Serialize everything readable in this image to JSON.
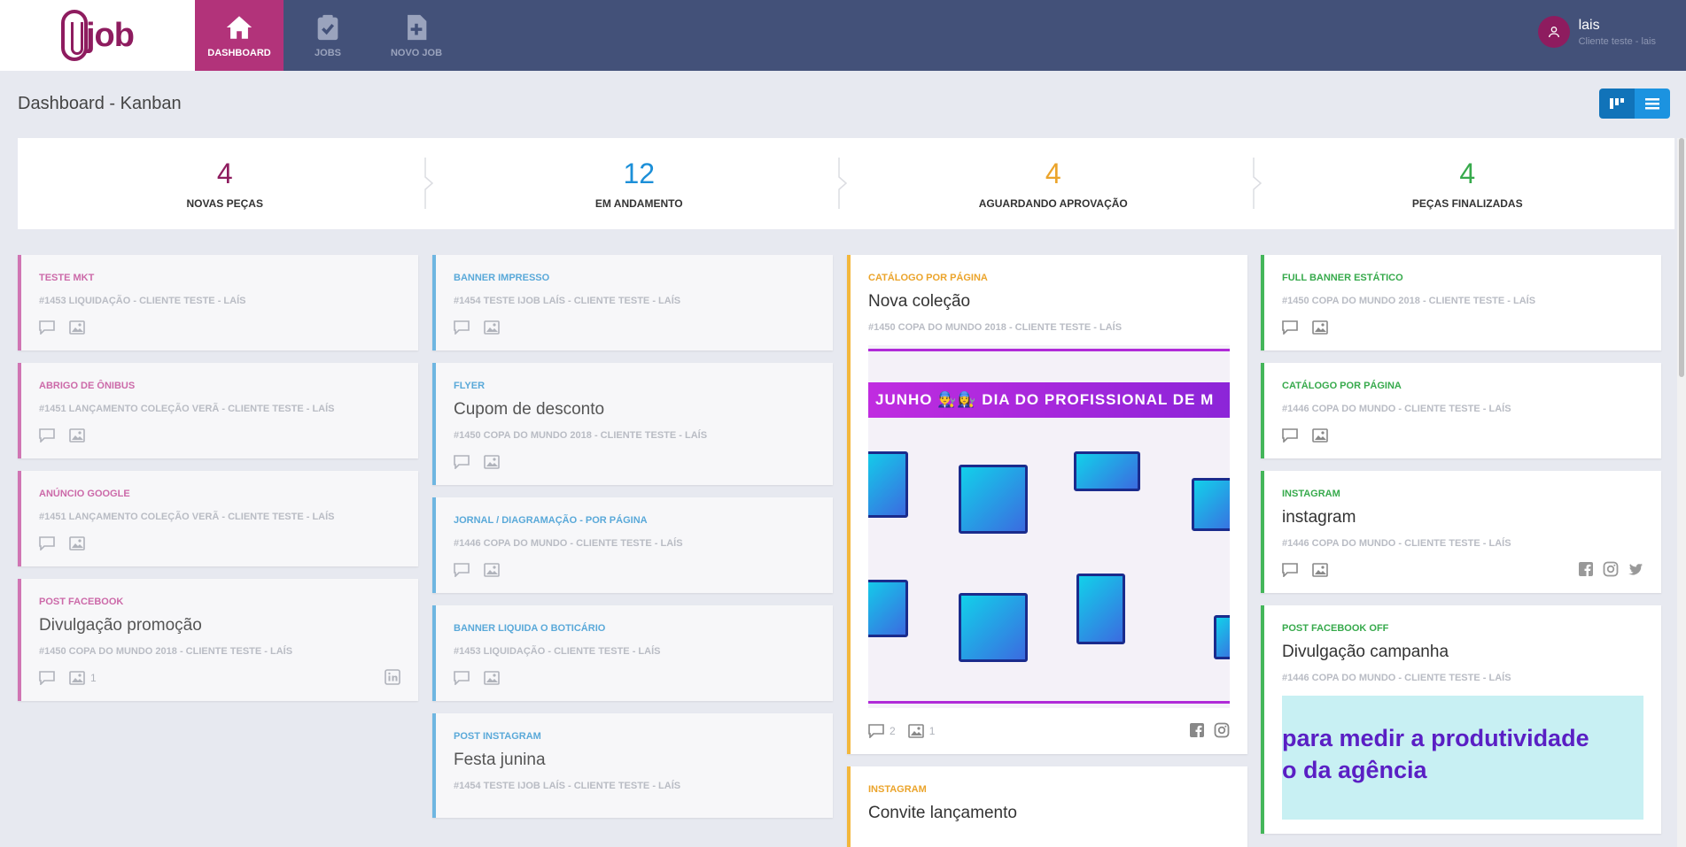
{
  "brand": {
    "logo_text": "job",
    "accent": "#b2337a",
    "nav_bg": "#435179"
  },
  "nav": [
    {
      "label": "DASHBOARD",
      "icon": "home-icon",
      "active": true
    },
    {
      "label": "JOBS",
      "icon": "clipboard-check-icon",
      "active": false
    },
    {
      "label": "NOVO JOB",
      "icon": "file-plus-icon",
      "active": false
    }
  ],
  "user": {
    "name": "lais",
    "subtitle": "Cliente teste - lais"
  },
  "page": {
    "title": "Dashboard - Kanban"
  },
  "stats": [
    {
      "value": "4",
      "label": "NOVAS PEÇAS",
      "color": "#8e1c5f"
    },
    {
      "value": "12",
      "label": "EM ANDAMENTO",
      "color": "#1c8fd8"
    },
    {
      "value": "4",
      "label": "AGUARDANDO APROVAÇÃO",
      "color": "#eba42b"
    },
    {
      "value": "4",
      "label": "PEÇAS FINALIZADAS",
      "color": "#37aa4c"
    }
  ],
  "columns": {
    "novas": [
      {
        "category": "TESTE MKT",
        "title": "",
        "ref": "#1453 LIQUIDAÇÃO - CLIENTE TESTE - LAÍS"
      },
      {
        "category": "ABRIGO DE ÔNIBUS",
        "title": "",
        "ref": "#1451 LANÇAMENTO COLEÇÃO VERÃ - CLIENTE TESTE - LAÍS"
      },
      {
        "category": "ANÚNCIO GOOGLE",
        "title": "",
        "ref": "#1451 LANÇAMENTO COLEÇÃO VERÃ - CLIENTE TESTE - LAÍS"
      },
      {
        "category": "POST FACEBOOK",
        "title": "Divulgação promoção",
        "ref": "#1450 COPA DO MUNDO 2018 - CLIENTE TESTE - LAÍS",
        "images": "1"
      }
    ],
    "andamento": [
      {
        "category": "BANNER IMPRESSO",
        "title": "",
        "ref": "#1454 TESTE IJOB LAÍS - CLIENTE TESTE - LAÍS"
      },
      {
        "category": "FLYER",
        "title": "Cupom de desconto",
        "ref": "#1450 COPA DO MUNDO 2018 - CLIENTE TESTE - LAÍS"
      },
      {
        "category": "JORNAL / DIAGRAMAÇÃO - POR PÁGINA",
        "title": "",
        "ref": "#1446 COPA DO MUNDO - CLIENTE TESTE - LAÍS"
      },
      {
        "category": "BANNER LIQUIDA O BOTICÁRIO",
        "title": "",
        "ref": "#1453 LIQUIDAÇÃO - CLIENTE TESTE - LAÍS"
      },
      {
        "category": "POST INSTAGRAM",
        "title": "Festa junina",
        "ref": "#1454 TESTE IJOB LAÍS - CLIENTE TESTE - LAÍS"
      }
    ],
    "aprovacao": [
      {
        "category": "CATÁLOGO POR PÁGINA",
        "title": "Nova coleção",
        "ref": "#1450 COPA DO MUNDO 2018 - CLIENTE TESTE - LAÍS",
        "image_banner": "JUNHO 👨‍🔧👩‍🔧 DIA DO PROFISSIONAL DE M",
        "comments": "2",
        "images": "1"
      },
      {
        "category": "INSTAGRAM",
        "title": "Convite lançamento"
      }
    ],
    "finalizadas": [
      {
        "category": "FULL BANNER ESTÁTICO",
        "title": "",
        "ref": "#1450 COPA DO MUNDO 2018 - CLIENTE TESTE - LAÍS"
      },
      {
        "category": "CATÁLOGO POR PÁGINA",
        "title": "",
        "ref": "#1446 COPA DO MUNDO - CLIENTE TESTE - LAÍS"
      },
      {
        "category": "INSTAGRAM",
        "title": "instagram",
        "ref": "#1446 COPA DO MUNDO - CLIENTE TESTE - LAÍS"
      },
      {
        "category": "POST FACEBOOK OFF",
        "title": "Divulgação campanha",
        "ref": "#1446 COPA DO MUNDO - CLIENTE TESTE - LAÍS",
        "image_line1": "para medir a produtividade",
        "image_line2": "o da agência"
      }
    ]
  }
}
